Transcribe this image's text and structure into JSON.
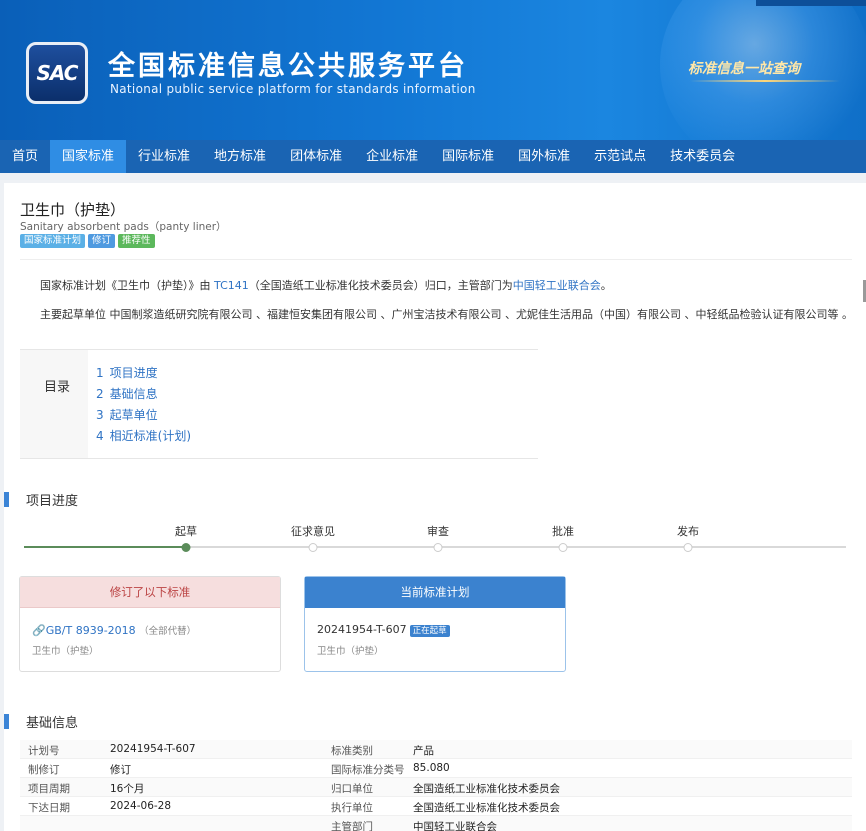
{
  "header": {
    "logo_text": "SAC",
    "title": "全国标准信息公共服务平台",
    "subtitle": "National public service platform  for standards information",
    "slogan": "标准信息一站查询"
  },
  "nav": {
    "items": [
      "首页",
      "国家标准",
      "行业标准",
      "地方标准",
      "团体标准",
      "企业标准",
      "国际标准",
      "国外标准",
      "示范试点",
      "技术委员会"
    ],
    "active_index": 1
  },
  "standard": {
    "title": "卫生巾（护垫）",
    "title_en": "Sanitary absorbent pads（panty liner）",
    "tags": [
      "国家标准计划",
      "修订",
      "推荐性"
    ],
    "desc1_prefix": "国家标准计划《卫生巾（护垫）》由 ",
    "desc1_tc": "TC141",
    "desc1_mid": "（全国造纸工业标准化技术委员会）归口，主管部门为",
    "desc1_dept": "中国轻工业联合会",
    "desc1_suffix": "。",
    "desc2": "主要起草单位 中国制浆造纸研究院有限公司 、福建恒安集团有限公司 、广州宝洁技术有限公司 、尤妮佳生活用品（中国）有限公司 、中轻纸品检验认证有限公司等 。"
  },
  "toc": {
    "label": "目录",
    "items": [
      {
        "num": "1",
        "label": "项目进度"
      },
      {
        "num": "2",
        "label": "基础信息"
      },
      {
        "num": "3",
        "label": "起草单位"
      },
      {
        "num": "4",
        "label": "相近标准(计划)"
      }
    ]
  },
  "progress": {
    "section_title": "项目进度",
    "stages": [
      "起草",
      "征求意见",
      "审查",
      "批准",
      "发布"
    ],
    "current_stage_index": 0
  },
  "revise_box": {
    "header": "修订了以下标准",
    "std_code": "GB/T 8939-2018",
    "replace_note": "（全部代替）",
    "name": "卫生巾（护垫）"
  },
  "current_box": {
    "header": "当前标准计划",
    "plan_no": "20241954-T-607",
    "status": "正在起草",
    "name": "卫生巾（护垫）"
  },
  "basic_info": {
    "section_title": "基础信息",
    "rows": [
      {
        "k1": "计划号",
        "v1": "20241954-T-607",
        "k2": "标准类别",
        "v2": "产品",
        "v2_link": false
      },
      {
        "k1": "制修订",
        "v1": "修订",
        "k2": "国际标准分类号",
        "v2": "85.080",
        "v2_link": false
      },
      {
        "k1": "项目周期",
        "v1": "16个月",
        "k2": "归口单位",
        "v2": "全国造纸工业标准化技术委员会",
        "v2_link": true
      },
      {
        "k1": "下达日期",
        "v1": "2024-06-28",
        "k2": "执行单位",
        "v2": "全国造纸工业标准化技术委员会",
        "v2_link": true
      },
      {
        "k1": "",
        "v1": "",
        "k2": "主管部门",
        "v2": "中国轻工业联合会",
        "v2_link": true
      }
    ]
  }
}
